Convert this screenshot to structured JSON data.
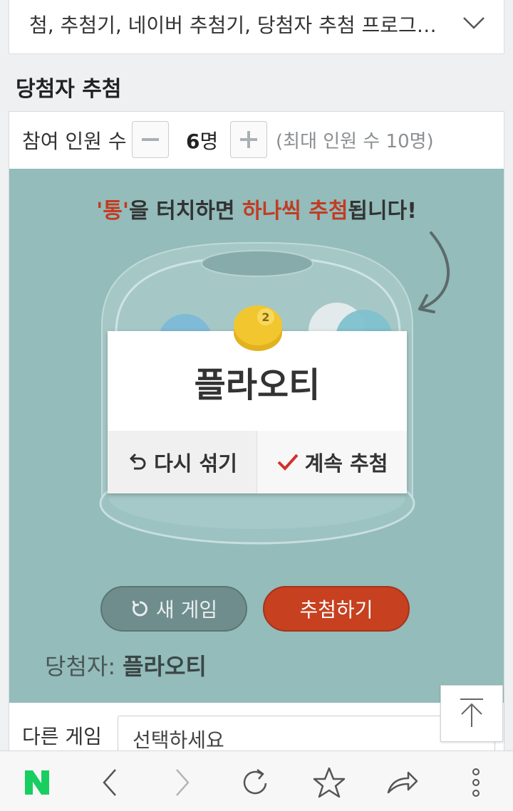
{
  "header": {
    "keywords_text": "첨, 추첨기, 네이버 추첨기, 당첨자 추첨 프로그…"
  },
  "section": {
    "title": "당첨자 추첨"
  },
  "participants": {
    "label": "참여 인원 수",
    "count": "6",
    "unit": "명",
    "max_text": "(최대 인원 수 10명)"
  },
  "stage": {
    "hint_quote_open": "'",
    "hint_tong": "통",
    "hint_quote_close": "'",
    "hint_mid": "을 터치하면 ",
    "hint_red": "하나씩 추첨",
    "hint_end": "됩니다!",
    "ball_number": "2",
    "ball_color": "#f2c62e",
    "accent_red": "#c23c22"
  },
  "result": {
    "name": "플라오티",
    "reshuffle_label": "다시 섞기",
    "continue_label": "계속 추첨"
  },
  "actions": {
    "new_game_label": "새 게임",
    "draw_label": "추첨하기"
  },
  "winner": {
    "label": "당첨자:",
    "name": "플라오티"
  },
  "other_game": {
    "label": "다른 게임",
    "select_value": "선택하세요"
  },
  "browser_nav": {
    "items": [
      "naver-home",
      "back",
      "forward",
      "reload",
      "bookmark",
      "share",
      "more"
    ],
    "logo_color": "#19ce60"
  }
}
